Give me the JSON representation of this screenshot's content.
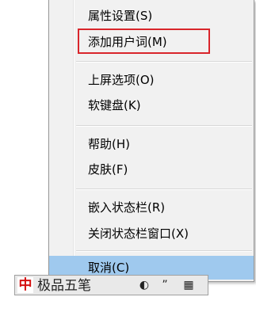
{
  "menu": {
    "items": [
      {
        "label": "属性设置(S)"
      },
      {
        "label": "添加用户词(M)"
      },
      {
        "label": "上屏选项(O)"
      },
      {
        "label": "软键盘(K)"
      },
      {
        "label": "帮助(H)"
      },
      {
        "label": "皮肤(F)"
      },
      {
        "label": "嵌入状态栏(R)"
      },
      {
        "label": "关闭状态栏窗口(X)"
      },
      {
        "label": "取消(C)"
      }
    ],
    "highlighted_item": "添加用户词(M)",
    "hovered_item": "取消(C)"
  },
  "statusbar": {
    "logo_char": "中",
    "ime_name": "极品五笔",
    "buttons": [
      "◐",
      "”",
      "▦"
    ]
  },
  "colors": {
    "annotation_box": "#d9252b",
    "hover_bg": "#9fc9ee",
    "logo": "#d41010"
  }
}
